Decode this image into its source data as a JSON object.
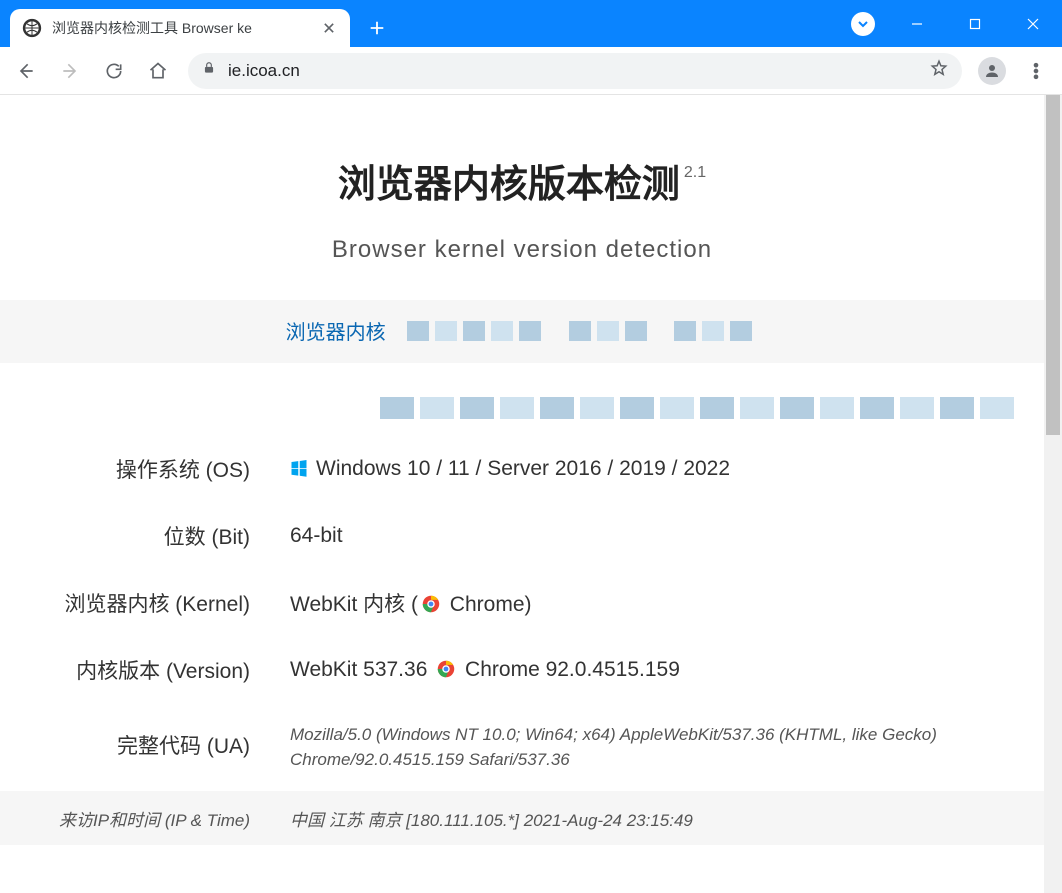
{
  "window": {
    "tab_title": "浏览器内核检测工具 Browser ke",
    "url": "ie.icoa.cn"
  },
  "page": {
    "title": "浏览器内核版本检测",
    "version_sup": "2.1",
    "subtitle": "Browser kernel version detection",
    "nav_label": "浏览器内核"
  },
  "info": {
    "os_label": "操作系统 (OS)",
    "os_value": "Windows 10 / 11 / Server 2016 / 2019 / 2022",
    "bit_label": "位数 (Bit)",
    "bit_value": "64-bit",
    "kernel_label": "浏览器内核 (Kernel)",
    "kernel_value_prefix": "WebKit 内核 (",
    "kernel_value_browser": " Chrome)",
    "version_label": "内核版本 (Version)",
    "version_value_prefix": "WebKit 537.36 ",
    "version_value_browser": " Chrome 92.0.4515.159",
    "ua_label": "完整代码 (UA)",
    "ua_value": "Mozilla/5.0 (Windows NT 10.0; Win64; x64) AppleWebKit/537.36 (KHTML, like Gecko) Chrome/92.0.4515.159 Safari/537.36",
    "meta_label": "来访IP和时间 (IP & Time)",
    "meta_value": "中国 江苏 南京 [180.111.105.*]   2021-Aug-24 23:15:49"
  }
}
